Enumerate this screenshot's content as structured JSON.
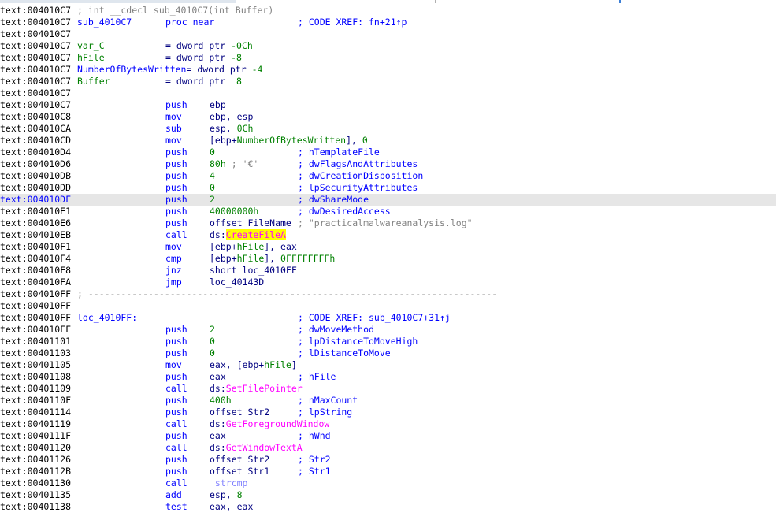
{
  "colors": {
    "background": "#ffffff",
    "address": "#000000",
    "keyword": "#0000ff",
    "number": "#008000",
    "api_import": "#ff00ff",
    "highlight_line": "#e6e6e6",
    "highlight_word": "#ffff00",
    "comment_gray": "#808080"
  },
  "rows": [
    {
      "addr": "text:004010C7",
      "full": "; int __cdecl sub_4010C7(int Buffer)"
    },
    {
      "addr": "text:004010C7",
      "label": "sub_4010C7",
      "mnem": "proc near",
      "comment": "; CODE XREF: fn+21↑p"
    },
    {
      "addr": "text:004010C7"
    },
    {
      "addr": "text:004010C7",
      "label": "var_C",
      "mnem": "= dword ptr -0Ch"
    },
    {
      "addr": "text:004010C7",
      "label": "hFile",
      "mnem": "= dword ptr -8"
    },
    {
      "addr": "text:004010C7",
      "label": "NumberOfBytesWritten= dword ptr -4"
    },
    {
      "addr": "text:004010C7",
      "label": "Buffer",
      "mnem": "= dword ptr  8"
    },
    {
      "addr": "text:004010C7"
    },
    {
      "addr": "text:004010C7",
      "mnem": "push",
      "ops": "ebp"
    },
    {
      "addr": "text:004010C8",
      "mnem": "mov",
      "ops": "ebp, esp"
    },
    {
      "addr": "text:004010CA",
      "mnem": "sub",
      "ops": "esp, 0Ch"
    },
    {
      "addr": "text:004010CD",
      "mnem": "mov",
      "ops": "[ebp+NumberOfBytesWritten], 0"
    },
    {
      "addr": "text:004010D4",
      "mnem": "push",
      "ops": "0",
      "comment": "; hTemplateFile"
    },
    {
      "addr": "text:004010D6",
      "mnem": "push",
      "ops": "80h ; '€'",
      "comment": "; dwFlagsAndAttributes"
    },
    {
      "addr": "text:004010DB",
      "mnem": "push",
      "ops": "4",
      "comment": "; dwCreationDisposition"
    },
    {
      "addr": "text:004010DD",
      "mnem": "push",
      "ops": "0",
      "comment": "; lpSecurityAttributes"
    },
    {
      "addr": "text:004010DF",
      "mnem": "push",
      "ops": "2",
      "comment": "; dwShareMode",
      "highlight": true
    },
    {
      "addr": "text:004010E1",
      "mnem": "push",
      "ops": "40000000h",
      "comment": "; dwDesiredAccess"
    },
    {
      "addr": "text:004010E6",
      "mnem": "push",
      "ops": "offset FileName",
      "comment": "; \"practicalmalwareanalysis.log\""
    },
    {
      "addr": "text:004010EB",
      "mnem": "call",
      "ops": "ds:CreateFileA"
    },
    {
      "addr": "text:004010F1",
      "mnem": "mov",
      "ops": "[ebp+hFile], eax"
    },
    {
      "addr": "text:004010F4",
      "mnem": "cmp",
      "ops": "[ebp+hFile], 0FFFFFFFFh"
    },
    {
      "addr": "text:004010F8",
      "mnem": "jnz",
      "ops": "short loc_4010FF"
    },
    {
      "addr": "text:004010FA",
      "mnem": "jmp",
      "ops": "loc_40143D"
    },
    {
      "addr": "text:004010FF",
      "full": "; ---------------------------------------------------------------------------"
    },
    {
      "addr": "text:004010FF"
    },
    {
      "addr": "text:004010FF",
      "label": "loc_4010FF:",
      "comment": "; CODE XREF: sub_4010C7+31↑j"
    },
    {
      "addr": "text:004010FF",
      "mnem": "push",
      "ops": "2",
      "comment": "; dwMoveMethod"
    },
    {
      "addr": "text:00401101",
      "mnem": "push",
      "ops": "0",
      "comment": "; lpDistanceToMoveHigh"
    },
    {
      "addr": "text:00401103",
      "mnem": "push",
      "ops": "0",
      "comment": "; lDistanceToMove"
    },
    {
      "addr": "text:00401105",
      "mnem": "mov",
      "ops": "eax, [ebp+hFile]"
    },
    {
      "addr": "text:00401108",
      "mnem": "push",
      "ops": "eax",
      "comment": "; hFile"
    },
    {
      "addr": "text:00401109",
      "mnem": "call",
      "ops": "ds:SetFilePointer"
    },
    {
      "addr": "text:0040110F",
      "mnem": "push",
      "ops": "400h",
      "comment": "; nMaxCount"
    },
    {
      "addr": "text:00401114",
      "mnem": "push",
      "ops": "offset Str2",
      "comment": "; lpString"
    },
    {
      "addr": "text:00401119",
      "mnem": "call",
      "ops": "ds:GetForegroundWindow"
    },
    {
      "addr": "text:0040111F",
      "mnem": "push",
      "ops": "eax",
      "comment": "; hWnd"
    },
    {
      "addr": "text:00401120",
      "mnem": "call",
      "ops": "ds:GetWindowTextA"
    },
    {
      "addr": "text:00401126",
      "mnem": "push",
      "ops": "offset Str2",
      "comment": "; Str2"
    },
    {
      "addr": "text:0040112B",
      "mnem": "push",
      "ops": "offset Str1",
      "comment": "; Str1"
    },
    {
      "addr": "text:00401130",
      "mnem": "call",
      "ops": "_strcmp"
    },
    {
      "addr": "text:00401135",
      "mnem": "add",
      "ops": "esp, 8"
    },
    {
      "addr": "text:00401138",
      "mnem": "test",
      "ops": "eax, eax"
    }
  ]
}
